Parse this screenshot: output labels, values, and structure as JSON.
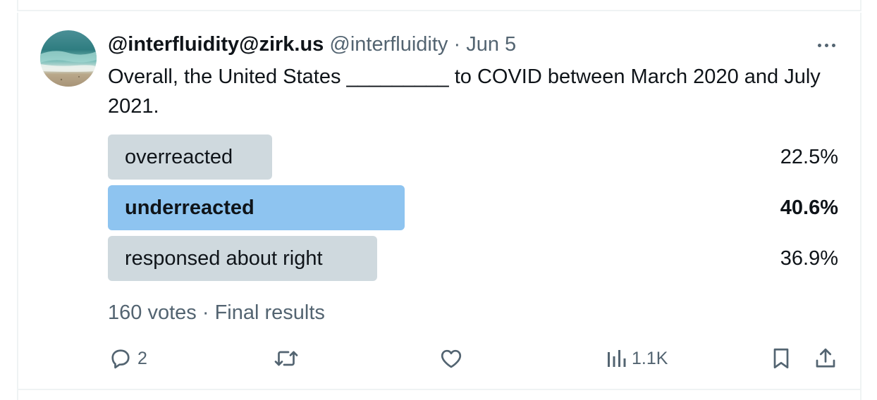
{
  "post": {
    "display_name": "@interfluidity@zirk.us",
    "handle": "@interfluidity",
    "separator": "·",
    "date": "Jun 5",
    "text": "Overall, the United States _________ to COVID between March 2020 and July 2021."
  },
  "poll": {
    "options": [
      {
        "label": "overreacted",
        "percent_text": "22.5%",
        "percent": 22.5,
        "winner": false
      },
      {
        "label": "underreacted",
        "percent_text": "40.6%",
        "percent": 40.6,
        "winner": true
      },
      {
        "label": "responsed about right",
        "percent_text": "36.9%",
        "percent": 36.9,
        "winner": false
      }
    ],
    "votes": "160 votes",
    "separator": "·",
    "status": "Final results"
  },
  "actions": {
    "reply_count": "2",
    "views_count": "1.1K"
  },
  "colors": {
    "bar_default": "#cfd9de",
    "bar_winner": "#8ec4f0",
    "muted_text": "#536471",
    "primary_text": "#0f1419"
  },
  "icons": [
    "reply-icon",
    "repost-icon",
    "like-icon",
    "views-icon",
    "bookmark-icon",
    "share-icon",
    "more-icon"
  ]
}
